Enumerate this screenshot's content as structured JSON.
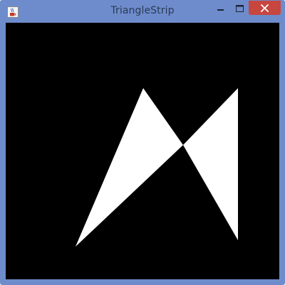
{
  "window": {
    "title": "TriangleStrip"
  },
  "colors": {
    "frame": "#6e8ccc",
    "title_text": "#2b3a55",
    "close_button": "#c7463f",
    "canvas_background": "#000000",
    "shape_fill": "#ffffff"
  },
  "icons": {
    "app": "java-coffee-cup-icon",
    "minimize": "minimize-icon",
    "maximize": "maximize-icon",
    "close": "close-icon"
  }
}
